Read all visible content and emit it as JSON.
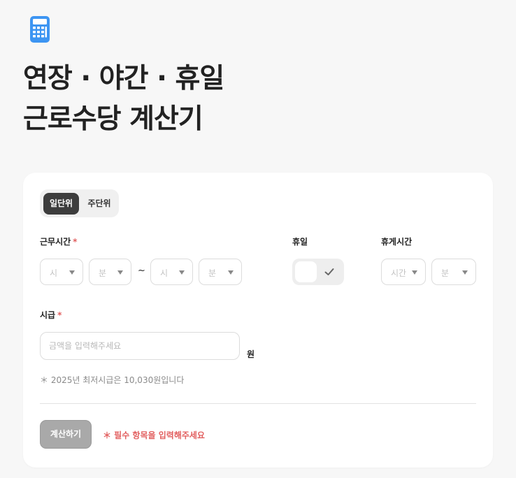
{
  "header": {
    "icon": "calculator-icon",
    "icon_color": "#3d95f2",
    "title_line1": "연장 · 야간 · 휴일",
    "title_line2": "근로수당 계산기"
  },
  "tabs": {
    "active": "일단위",
    "inactive": "주단위"
  },
  "work_time": {
    "label": "근무시간",
    "required_mark": "*",
    "start_hour_placeholder": "시",
    "start_min_placeholder": "분",
    "separator": "~",
    "end_hour_placeholder": "시",
    "end_min_placeholder": "분"
  },
  "holiday": {
    "label": "휴일",
    "toggle_icon": "check-icon"
  },
  "break_time": {
    "label": "휴게시간",
    "hour_placeholder": "시간",
    "min_placeholder": "분"
  },
  "wage": {
    "label": "시급",
    "required_mark": "*",
    "placeholder": "금액을 입력해주세요",
    "value": "",
    "unit": "원",
    "note": "＊ 2025년 최저시급은 10,030원입니다"
  },
  "actions": {
    "calculate_label": "계산하기",
    "warning": "＊  필수 항목을 입력해주세요"
  },
  "colors": {
    "accent_required": "#e26060",
    "tab_active_bg": "#3d3d3d",
    "button_disabled_bg": "#a9a9a9"
  }
}
